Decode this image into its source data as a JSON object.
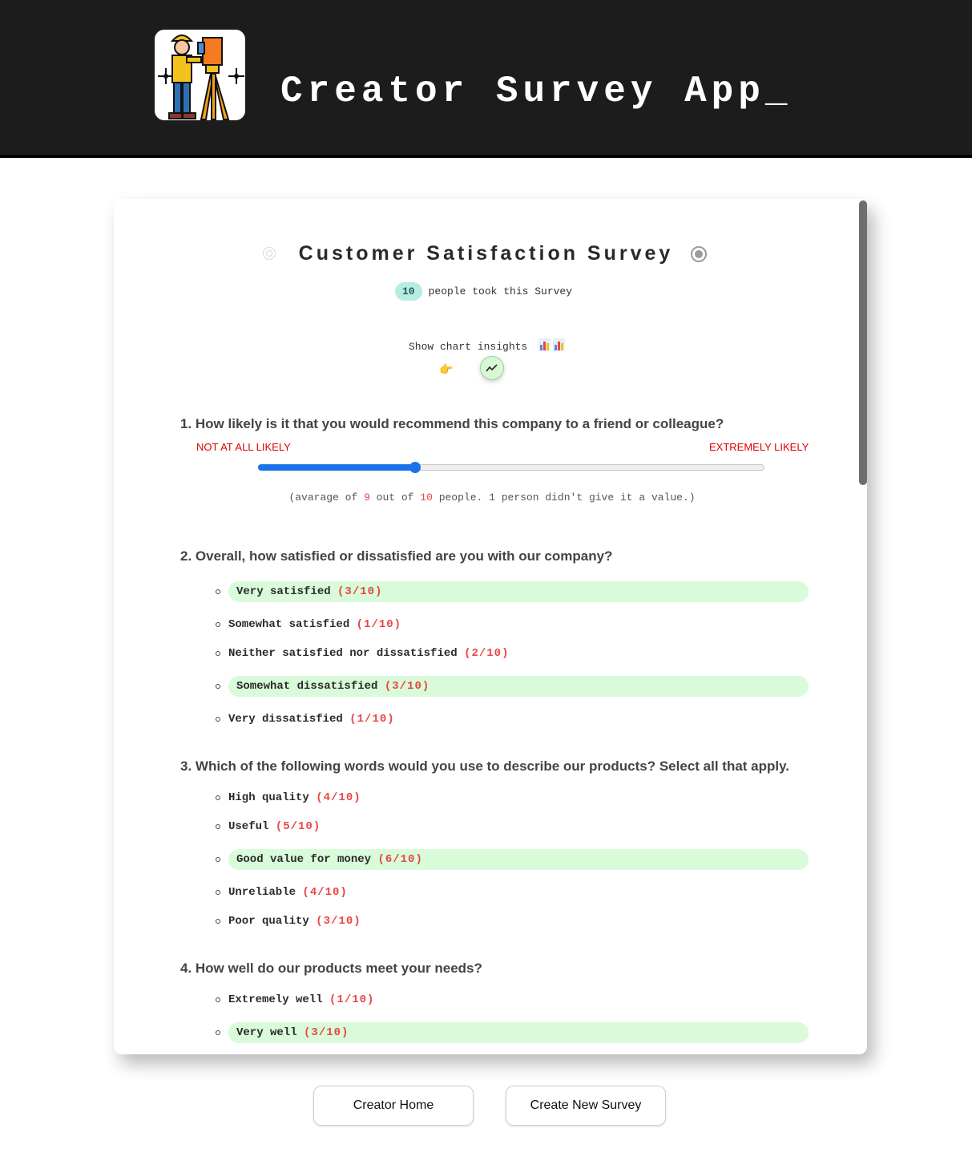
{
  "app": {
    "title": "Creator Survey App_"
  },
  "survey": {
    "title": "Customer Satisfaction Survey",
    "respondents": "10",
    "respondents_label": "people took this Survey",
    "insights_label": "Show chart insights"
  },
  "questions": {
    "q1": {
      "title": "1. How likely is it that you would recommend this company to a friend or colleague?",
      "scale_low": "NOT AT ALL LIKELY",
      "scale_high": "EXTREMELY LIKELY",
      "slider_value_fraction": 0.31,
      "avg_prefix": "(avarage of ",
      "avg_count": "9",
      "avg_mid": " out of ",
      "avg_total": "10",
      "avg_suffix": " people. 1 person didn't give it a value.)"
    },
    "q2": {
      "title": "2. Overall, how satisfied or dissatisfied are you with our company?",
      "options": [
        {
          "label": "Very satisfied",
          "count": "(3/10)",
          "highlight": true
        },
        {
          "label": "Somewhat satisfied",
          "count": "(1/10)",
          "highlight": false
        },
        {
          "label": "Neither satisfied nor dissatisfied",
          "count": "(2/10)",
          "highlight": false
        },
        {
          "label": "Somewhat dissatisfied",
          "count": "(3/10)",
          "highlight": true
        },
        {
          "label": "Very dissatisfied",
          "count": "(1/10)",
          "highlight": false
        }
      ]
    },
    "q3": {
      "title": "3. Which of the following words would you use to describe our products? Select all that apply.",
      "options": [
        {
          "label": "High quality",
          "count": "(4/10)",
          "highlight": false
        },
        {
          "label": "Useful",
          "count": "(5/10)",
          "highlight": false
        },
        {
          "label": "Good value for money",
          "count": "(6/10)",
          "highlight": true
        },
        {
          "label": "Unreliable",
          "count": "(4/10)",
          "highlight": false
        },
        {
          "label": "Poor quality",
          "count": "(3/10)",
          "highlight": false
        }
      ]
    },
    "q4": {
      "title": "4. How well do our products meet your needs?",
      "options": [
        {
          "label": "Extremely well",
          "count": "(1/10)",
          "highlight": false
        },
        {
          "label": "Very well",
          "count": "(3/10)",
          "highlight": true
        }
      ]
    }
  },
  "footer": {
    "home_button": "Creator Home",
    "new_survey_button": "Create New Survey"
  },
  "colors": {
    "header_bg": "#1c1c1c",
    "accent_blue": "#1a73e8",
    "highlight_green": "#d9fbd9",
    "count_red": "#e84545",
    "scale_red": "#e00000",
    "badge_teal": "#b7ece2"
  },
  "icons": {
    "logo": "surveyor-worker-icon",
    "insights": "bar-chart-icon",
    "toggle": "trend-line-icon",
    "pointer": "pointing-hand-icon"
  }
}
